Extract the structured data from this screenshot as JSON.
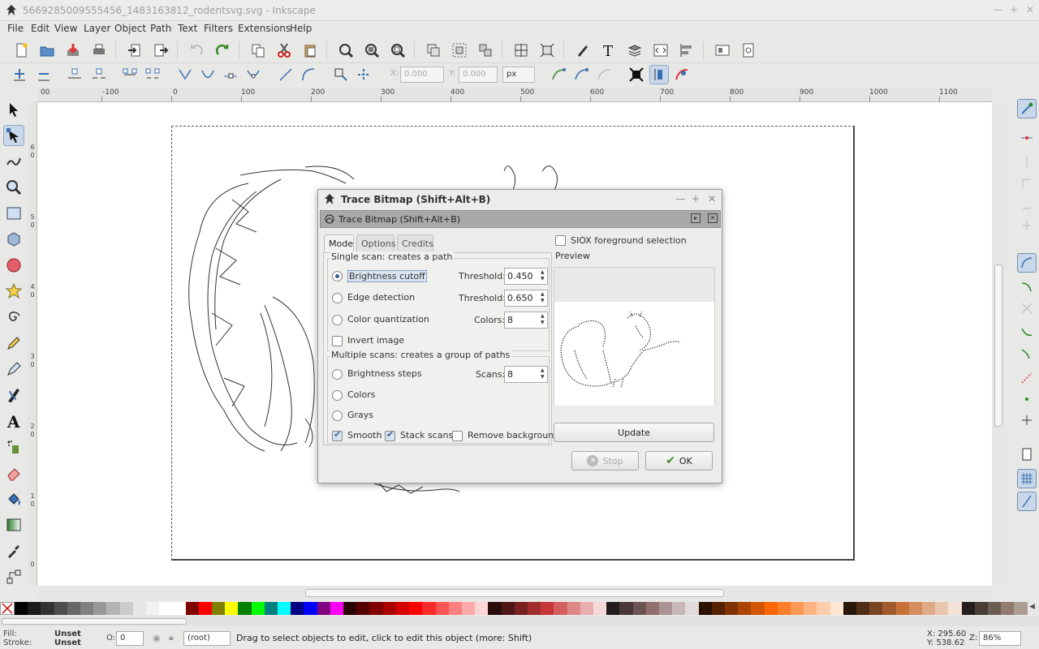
{
  "window": {
    "title": "5669285009555456_1483163812_rodentsvg.svg - Inkscape"
  },
  "menu": [
    "File",
    "Edit",
    "View",
    "Layer",
    "Object",
    "Path",
    "Text",
    "Filters",
    "Extensions",
    "Help"
  ],
  "controls": {
    "x_label": "X:",
    "x_value": "0.000",
    "y_label": "Y:",
    "y_value": "0.000",
    "unit": "px"
  },
  "ruler_top": [
    "00",
    "-100",
    "0",
    "100",
    "200",
    "300",
    "400",
    "500",
    "600",
    "700",
    "800",
    "900",
    "1000",
    "1100"
  ],
  "ruler_left": [
    "6",
    "0",
    "5",
    "0",
    "4",
    "0",
    "3",
    "0",
    "2",
    "0",
    "1",
    "0",
    "0"
  ],
  "dialog": {
    "title": "Trace Bitmap (Shift+Alt+B)",
    "subtitle": "Trace Bitmap (Shift+Alt+B)",
    "tabs": [
      "Mode",
      "Options",
      "Credits"
    ],
    "single_scan": {
      "title": "Single scan: creates a path",
      "brightness": {
        "label": "Brightness cutoff",
        "param": "Threshold:",
        "value": "0.450"
      },
      "edge": {
        "label": "Edge detection",
        "param": "Threshold:",
        "value": "0.650"
      },
      "color": {
        "label": "Color quantization",
        "param": "Colors:",
        "value": "8"
      },
      "invert": "Invert image"
    },
    "multi_scan": {
      "title": "Multiple scans: creates a group of paths",
      "steps": {
        "label": "Brightness steps",
        "param": "Scans:",
        "value": "8"
      },
      "colors": "Colors",
      "grays": "Grays",
      "smooth": "Smooth",
      "stack": "Stack scans",
      "remove_bg": "Remove background"
    },
    "siox": "SIOX foreground selection",
    "preview_label": "Preview",
    "update_btn": "Update",
    "stop_btn": "Stop",
    "ok_btn": "OK"
  },
  "palette": [
    "#000000",
    "#1a1a1a",
    "#333333",
    "#4d4d4d",
    "#666666",
    "#808080",
    "#999999",
    "#b3b3b3",
    "#cccccc",
    "#e6e6e6",
    "#f2f2f2",
    "#ffffff",
    "#ffffff",
    "#800000",
    "#ff0000",
    "#808000",
    "#ffff00",
    "#008000",
    "#00ff00",
    "#008080",
    "#00ffff",
    "#000080",
    "#0000ff",
    "#800080",
    "#ff00ff",
    "#2b0000",
    "#550000",
    "#800000",
    "#aa0000",
    "#d40000",
    "#ff0000",
    "#ff2a2a",
    "#ff5555",
    "#ff8080",
    "#ffaaaa",
    "#ffd5d5",
    "#280b0b",
    "#501616",
    "#782121",
    "#a02c2c",
    "#c83737",
    "#d35f5f",
    "#de8787",
    "#e9afaf",
    "#f4d7d7",
    "#241c1c",
    "#483737",
    "#6c5353",
    "#916f6f",
    "#ac9393",
    "#c8b7b7",
    "#e3dbdb",
    "#2b1100",
    "#552200",
    "#803300",
    "#aa4400",
    "#d45500",
    "#ff6600",
    "#ff7f2a",
    "#ff9955",
    "#ffb380",
    "#ffccaa",
    "#ffe6d5",
    "#28170b",
    "#502d16",
    "#784421",
    "#a05a2c",
    "#c87137",
    "#d38d5f",
    "#deaa87",
    "#e9c6af",
    "#f4e3d7",
    "#241f1c",
    "#483e37",
    "#6c5d53",
    "#917c6f",
    "#ac9d93"
  ],
  "status": {
    "fill_label": "Fill:",
    "fill_value": "Unset",
    "stroke_label": "Stroke:",
    "stroke_value": "Unset",
    "opacity_label": "O:",
    "opacity_value": "0",
    "layer": "(root)",
    "message": "Drag to select objects to edit, click to edit this object (more: Shift)",
    "x": "X: 295.60",
    "y": "Y: 538.62",
    "zoom_label": "Z:",
    "zoom": "86%"
  }
}
